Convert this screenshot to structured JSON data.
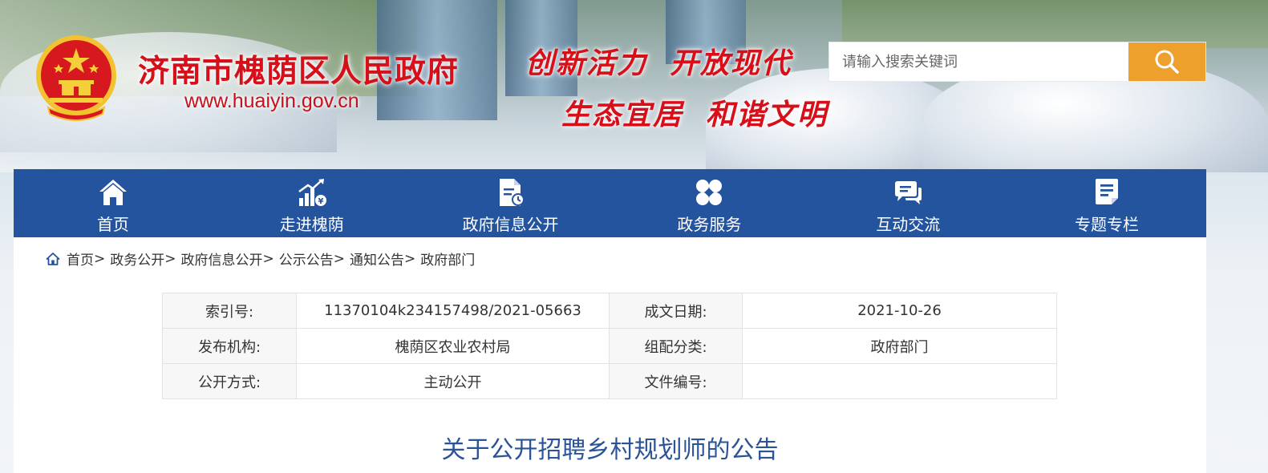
{
  "header": {
    "site_name": "济南市槐荫区人民政府",
    "site_url": "www.huaiyin.gov.cn",
    "slogan_line1": [
      "创新活力",
      "开放现代"
    ],
    "slogan_line2": [
      "生态宜居",
      "和谐文明"
    ],
    "emblem_icon": "national-emblem-icon",
    "brand_color": "#d6101a"
  },
  "search": {
    "placeholder": "请输入搜索关键词",
    "button_icon": "search-icon",
    "button_color": "#eea02c"
  },
  "nav": {
    "background": "#24549e",
    "items": [
      {
        "label": "首页",
        "icon": "home-icon"
      },
      {
        "label": "走进槐荫",
        "icon": "chart-growth-icon"
      },
      {
        "label": "政府信息公开",
        "icon": "document-icon"
      },
      {
        "label": "政务服务",
        "icon": "grid-petals-icon"
      },
      {
        "label": "互动交流",
        "icon": "chat-bubbles-icon"
      },
      {
        "label": "专题专栏",
        "icon": "notes-icon"
      }
    ]
  },
  "breadcrumb": {
    "icon": "home-outline-icon",
    "items": [
      "首页",
      "政务公开",
      "政府信息公开",
      "公示公告",
      "通知公告",
      "政府部门"
    ],
    "separator": ">"
  },
  "meta": {
    "rows": [
      {
        "label1": "索引号:",
        "value1": "11370104k234157498/2021-05663",
        "label2": "成文日期:",
        "value2": "2021-10-26"
      },
      {
        "label1": "发布机构:",
        "value1": "槐荫区农业农村局",
        "label2": "组配分类:",
        "value2": "政府部门"
      },
      {
        "label1": "公开方式:",
        "value1": "主动公开",
        "label2": "文件编号:",
        "value2": ""
      }
    ]
  },
  "document": {
    "title": "关于公开招聘乡村规划师的公告",
    "title_color": "#2a5496"
  }
}
